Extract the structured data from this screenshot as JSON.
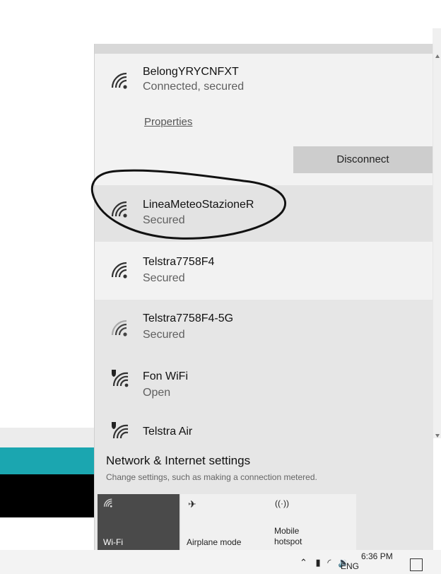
{
  "networks": [
    {
      "name": "BelongYRYCNFXT",
      "status": "Connected, secured",
      "properties_label": "Properties",
      "disconnect_label": "Disconnect"
    },
    {
      "name": "LineaMeteoStazioneR",
      "status": "Secured"
    },
    {
      "name": "Telstra7758F4",
      "status": "Secured"
    },
    {
      "name": "Telstra7758F4-5G",
      "status": "Secured"
    },
    {
      "name": "Fon WiFi",
      "status": "Open"
    },
    {
      "name": "Telstra Air",
      "status": ""
    }
  ],
  "settings": {
    "title": "Network & Internet settings",
    "subtitle": "Change settings, such as making a connection metered."
  },
  "quick_actions": [
    {
      "label": "Wi-Fi",
      "icon": "wifi-icon",
      "active": true
    },
    {
      "label": "Airplane mode",
      "icon": "airplane-icon",
      "active": false
    },
    {
      "label": "Mobile hotspot",
      "icon": "hotspot-icon",
      "active": false
    }
  ],
  "taskbar": {
    "time": "6:36 PM",
    "language": "ENG"
  },
  "colors": {
    "active_tile": "#4a4a4a",
    "flyout_bg": "#e6e6e6",
    "teal_app": "#1ba6b0"
  }
}
